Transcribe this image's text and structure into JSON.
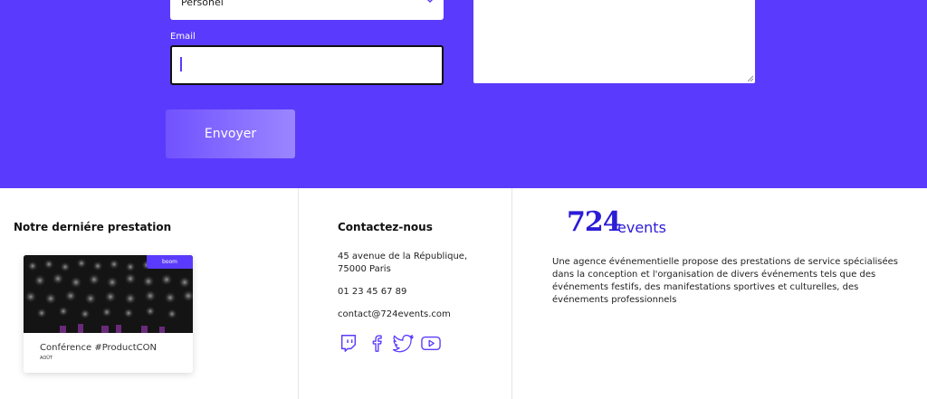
{
  "form": {
    "select_value": "Personel",
    "email_label": "Email",
    "email_value": "",
    "send_label": "Envoyer"
  },
  "footer": {
    "last_event": {
      "title": "Notre derniére prestation",
      "badge": "boom",
      "event_title": "Conférence #ProductCON",
      "event_month": "AOÛT"
    },
    "contact": {
      "title": "Contactez-nous",
      "address_line1": "45 avenue de la République,",
      "address_line2": "75000 Paris",
      "phone": "01 23 45 67 89",
      "email": "contact@724events.com",
      "socials": [
        "twitch-icon",
        "facebook-icon",
        "twitter-icon",
        "youtube-icon"
      ]
    },
    "brand": {
      "logo_number": "724",
      "logo_word": "events",
      "description": "Une agence événementielle propose des prestations de service spécialisées dans la conception et l'organisation de divers événements tels que des événements festifs, des manifestations sportives et culturelles, des événements professionnels"
    }
  },
  "colors": {
    "accent": "#5a3bfd",
    "logo": "#2b1cd6"
  }
}
